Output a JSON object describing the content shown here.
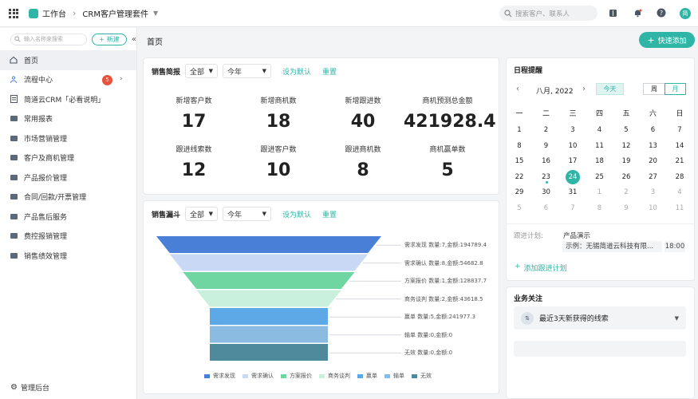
{
  "topbar": {
    "workbench": "工作台",
    "breadcrumb_sep": "›",
    "app_name": "CRM客户管理套件",
    "search_placeholder": "搜索客户、联系人",
    "avatar_text": "简"
  },
  "sidebar": {
    "search_placeholder": "输入名称来搜索",
    "new_label": "新建",
    "items": [
      {
        "label": "首页",
        "icon": "home-icon"
      },
      {
        "label": "流程中心",
        "icon": "flow-icon",
        "badge": "5"
      },
      {
        "label": "简道云CRM「必看说明」",
        "icon": "doc-icon"
      },
      {
        "label": "常用报表",
        "icon": "folder-icon"
      },
      {
        "label": "市场营销管理",
        "icon": "folder-icon"
      },
      {
        "label": "客户及商机管理",
        "icon": "folder-icon"
      },
      {
        "label": "产品报价管理",
        "icon": "folder-icon"
      },
      {
        "label": "合同/回款/开票管理",
        "icon": "folder-icon"
      },
      {
        "label": "产品售后服务",
        "icon": "folder-icon"
      },
      {
        "label": "费控报销管理",
        "icon": "folder-icon"
      },
      {
        "label": "销售绩效管理",
        "icon": "folder-icon"
      }
    ],
    "admin_label": "管理后台"
  },
  "main": {
    "page_title": "首页",
    "quick_add": "快速添加"
  },
  "sales_brief": {
    "title": "销售简报",
    "filter_scope": "全部",
    "filter_period": "今年",
    "set_default": "设为默认",
    "reset": "重置",
    "kpis": [
      {
        "label": "新增客户数",
        "value": "17"
      },
      {
        "label": "新增商机数",
        "value": "18"
      },
      {
        "label": "新增跟进数",
        "value": "40"
      },
      {
        "label": "商机预测总金额",
        "value": "421928.4"
      },
      {
        "label": "跟进线索数",
        "value": "12"
      },
      {
        "label": "跟进客户数",
        "value": "10"
      },
      {
        "label": "跟进商机数",
        "value": "8"
      },
      {
        "label": "商机赢单数",
        "value": "5"
      }
    ]
  },
  "funnel": {
    "title": "销售漏斗",
    "filter_scope": "全部",
    "filter_period": "今年",
    "set_default": "设为默认",
    "reset": "重置",
    "colors": [
      "#4a7fd8",
      "#c9d8f5",
      "#6fd6a2",
      "#c8f0dc",
      "#5da8e6",
      "#8bbbe0",
      "#4e8a9c"
    ]
  },
  "chart_data": {
    "type": "funnel",
    "categories": [
      "需求发现",
      "需求确认",
      "方案报价",
      "商务谈判",
      "赢单",
      "输单",
      "无效"
    ],
    "counts": [
      7,
      8,
      1,
      2,
      5,
      0,
      0
    ],
    "amounts": [
      194789.4,
      54682.8,
      128837.7,
      43618.5,
      241977.3,
      0,
      0
    ],
    "labels": [
      "需求发现 数量:7,金额:194789.4",
      "需求确认 数量:8,金额:54682.8",
      "方案报价 数量:1,金额:128837.7",
      "商务谈判 数量:2,金额:43618.5",
      "赢单 数量:5,金额:241977.3",
      "输单 数量:0,金额:0",
      "无效 数量:0,金额:0"
    ]
  },
  "calendar": {
    "title": "日程提醒",
    "month_label": "八月, 2022",
    "today_btn": "今天",
    "week_btn": "周",
    "month_btn": "月",
    "weekdays": [
      "一",
      "二",
      "三",
      "四",
      "五",
      "六",
      "日"
    ],
    "rows": [
      [
        "1",
        "2",
        "3",
        "4",
        "5",
        "6",
        "7"
      ],
      [
        "8",
        "9",
        "10",
        "11",
        "12",
        "13",
        "14"
      ],
      [
        "15",
        "16",
        "17",
        "18",
        "19",
        "20",
        "21"
      ],
      [
        "22",
        "23",
        "24",
        "25",
        "26",
        "27",
        "28"
      ],
      [
        "29",
        "30",
        "31",
        "1",
        "2",
        "3",
        "4"
      ],
      [
        "5",
        "6",
        "7",
        "8",
        "9",
        "10",
        "11"
      ]
    ],
    "today": "24",
    "plan_label": "跟进计划:",
    "plan_title": "产品演示",
    "plan_detail": "示例：无锡简道云科技有限...",
    "plan_time": "18:00",
    "add_plan": "添加跟进计划"
  },
  "focus": {
    "title": "业务关注",
    "item": "最近3天新获得的线索"
  }
}
